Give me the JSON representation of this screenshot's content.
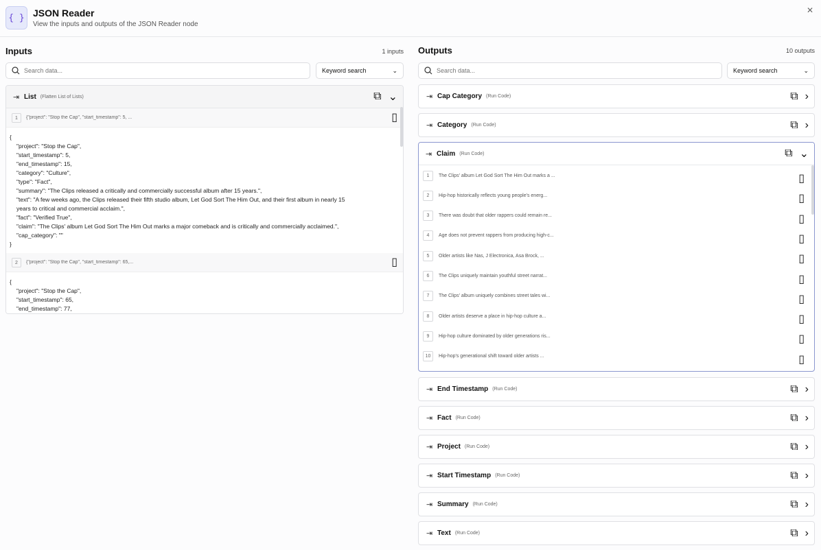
{
  "window": {
    "title": "JSON Reader",
    "subtitle": "View the inputs and outputs of the JSON Reader node"
  },
  "inputs": {
    "title": "Inputs",
    "count": "1 inputs",
    "search_placeholder": "Search data...",
    "search_mode": "Keyword search",
    "group": {
      "name": "List",
      "subtitle": "(Flatten List of Lists)"
    },
    "rows": [
      {
        "index": "1",
        "preview": "{\"project\": \"Stop the Cap\", \"start_timestamp\": 5, ...",
        "lines": [
          "{",
          "\"project\": \"Stop the Cap\",",
          "\"start_timestamp\": 5,",
          "\"end_timestamp\": 15,",
          "\"category\": \"Culture\",",
          "\"type\": \"Fact\",",
          "\"summary\": \"The Clips released a critically and commercially successful album after 15 years.\",",
          "\"text\": \"A few weeks ago, the Clips released their fifth studio album, Let God Sort The Him Out, and their first album in nearly 15",
          "years to critical and commercial acclaim.\",",
          "\"fact\": \"Verified True\",",
          "\"claim\": \"The Clips' album Let God Sort The Him Out marks a major comeback and is critically and commercially acclaimed.\",",
          "\"cap_category\": \"\"",
          "}"
        ]
      },
      {
        "index": "2",
        "preview": "{\"project\": \"Stop the Cap\", \"start_timestamp\": 65,...",
        "lines": [
          "{",
          "\"project\": \"Stop the Cap\",",
          "\"start_timestamp\": 65,",
          "\"end_timestamp\": 77,"
        ]
      }
    ]
  },
  "outputs": {
    "title": "Outputs",
    "count": "10 outputs",
    "search_placeholder": "Search data...",
    "search_mode": "Keyword search",
    "items": [
      {
        "name": "Cap Category",
        "source": "(Run Code)"
      },
      {
        "name": "Category",
        "source": "(Run Code)"
      },
      {
        "name": "Claim",
        "source": "(Run Code)"
      },
      {
        "name": "End Timestamp",
        "source": "(Run Code)"
      },
      {
        "name": "Fact",
        "source": "(Run Code)"
      },
      {
        "name": "Project",
        "source": "(Run Code)"
      },
      {
        "name": "Start Timestamp",
        "source": "(Run Code)"
      },
      {
        "name": "Summary",
        "source": "(Run Code)"
      },
      {
        "name": "Text",
        "source": "(Run Code)"
      }
    ],
    "claim_values": [
      "The Clips' album Let God Sort The Him Out marks a ...",
      "Hip-hop historically reflects young people's energ...",
      "There was doubt that older rappers could remain re...",
      "Age does not prevent rappers from producing high-c...",
      "Older artists like Nas, J Electronica, Asa Brock, ...",
      "The Clips uniquely maintain youthful street narrat...",
      "The Clips' album uniquely combines street tales wi...",
      "Older artists deserve a place in hip-hop culture a...",
      "Hip-hop culture dominated by older generations ris...",
      "Hip-hop's generational shift toward older artists ..."
    ]
  }
}
